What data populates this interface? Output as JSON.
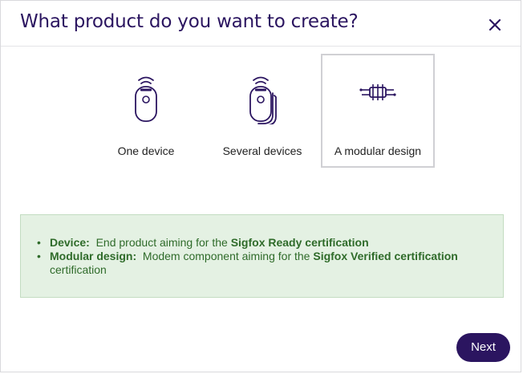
{
  "dialog": {
    "title": "What product do you want to create?",
    "close_icon": "close-icon"
  },
  "options": [
    {
      "label": "One device",
      "icon": "single-device-icon",
      "selected": false
    },
    {
      "label": "Several devices",
      "icon": "multiple-devices-icon",
      "selected": false
    },
    {
      "label": "A modular design",
      "icon": "module-chip-icon",
      "selected": true
    }
  ],
  "info": {
    "items": [
      {
        "term": "Device:",
        "text": "End product aiming for the",
        "strong": "Sigfox Ready certification",
        "tail": ""
      },
      {
        "term": "Modular design:",
        "text": "Modem component aiming for the",
        "strong": "Sigfox Verified certification",
        "tail": "certification"
      }
    ]
  },
  "footer": {
    "next_label": "Next"
  },
  "colors": {
    "brand": "#2b1560",
    "info_bg": "#e4f1e3",
    "info_text": "#2f6b2a"
  }
}
